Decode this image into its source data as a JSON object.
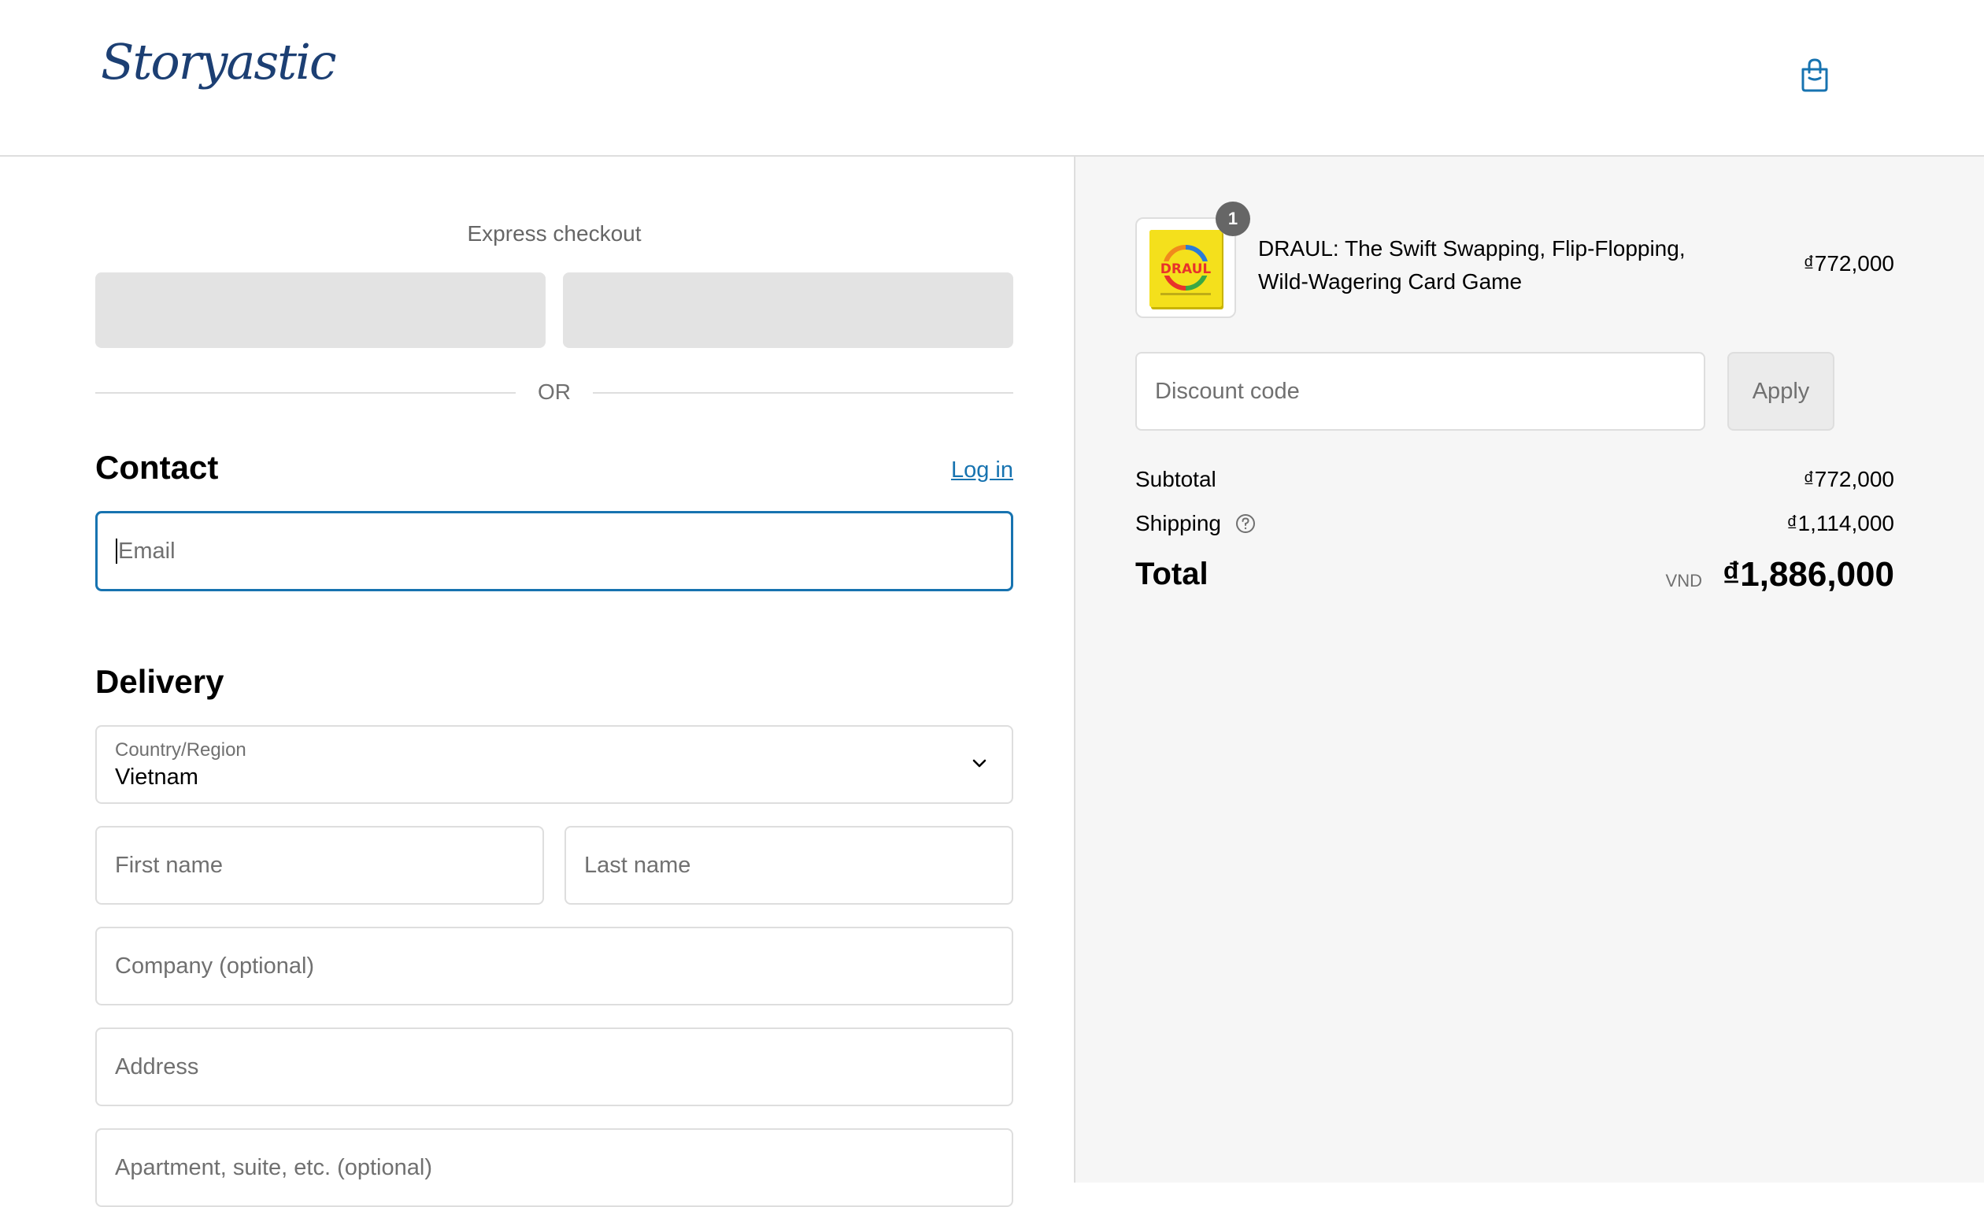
{
  "header": {
    "logo_text": "Storyastic",
    "cart_icon": "shopping-bag-icon"
  },
  "express": {
    "title": "Express checkout",
    "or_label": "OR"
  },
  "contact": {
    "title": "Contact",
    "login_label": "Log in",
    "email_placeholder": "Email"
  },
  "delivery": {
    "title": "Delivery",
    "country_label": "Country/Region",
    "country_value": "Vietnam",
    "first_name_placeholder": "First name",
    "last_name_placeholder": "Last name",
    "company_placeholder": "Company (optional)",
    "address_placeholder": "Address",
    "apartment_placeholder": "Apartment, suite, etc. (optional)"
  },
  "order": {
    "product": {
      "name": "DRAUL: The Swift Swapping, Flip-Flopping, Wild-Wagering Card Game",
      "price": "₫772,000",
      "quantity": "1",
      "image_text": "DRAUL"
    },
    "discount_placeholder": "Discount code",
    "apply_label": "Apply",
    "subtotal_label": "Subtotal",
    "subtotal_value": "₫772,000",
    "shipping_label": "Shipping",
    "shipping_value": "₫1,114,000",
    "total_label": "Total",
    "total_currency": "VND",
    "total_value": "₫1,886,000"
  },
  "colors": {
    "accent": "#1773b0",
    "logo": "#1c3f73",
    "summary_bg": "#f6f6f6"
  }
}
